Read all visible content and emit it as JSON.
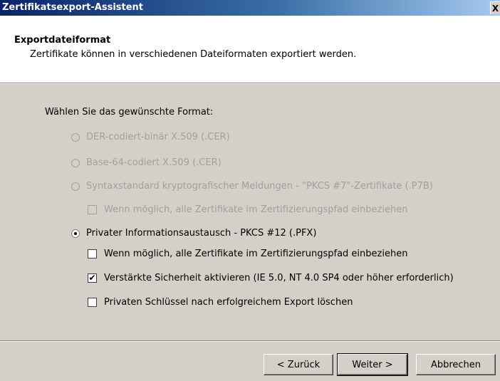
{
  "window": {
    "title": "Zertifikatsexport-Assistent",
    "close_glyph": "X"
  },
  "header": {
    "title": "Exportdateiformat",
    "subtitle": "Zertifikate können in verschiedenen Dateiformaten exportiert werden."
  },
  "content": {
    "prompt": "Wählen Sie das gewünschte Format:",
    "options": [
      {
        "label": "DER-codiert-binär X.509 (.CER)",
        "enabled": false,
        "selected": false
      },
      {
        "label": "Base-64-codiert X.509 (.CER)",
        "enabled": false,
        "selected": false
      },
      {
        "label": "Syntaxstandard kryptografischer Meldungen - \"PKCS #7\"-Zertifikate (.P7B)",
        "enabled": false,
        "selected": false
      },
      {
        "label": "Privater Informationsaustausch - PKCS #12 (.PFX)",
        "enabled": true,
        "selected": true
      }
    ],
    "p7b_checkbox": {
      "label": "Wenn möglich, alle Zertifikate im Zertifizierungspfad einbeziehen",
      "checked": false,
      "enabled": false
    },
    "pfx_checkboxes": [
      {
        "label": "Wenn möglich, alle Zertifikate im Zertifizierungspfad einbeziehen",
        "checked": false
      },
      {
        "label": "Verstärkte Sicherheit aktivieren (IE 5.0, NT 4.0 SP4 oder höher erforderlich)",
        "checked": true,
        "mark": "✔"
      },
      {
        "label": "Privaten Schlüssel nach erfolgreichem Export löschen",
        "checked": false
      }
    ]
  },
  "buttons": {
    "back": "< Zurück",
    "next": "Weiter >",
    "cancel": "Abbrechen"
  }
}
